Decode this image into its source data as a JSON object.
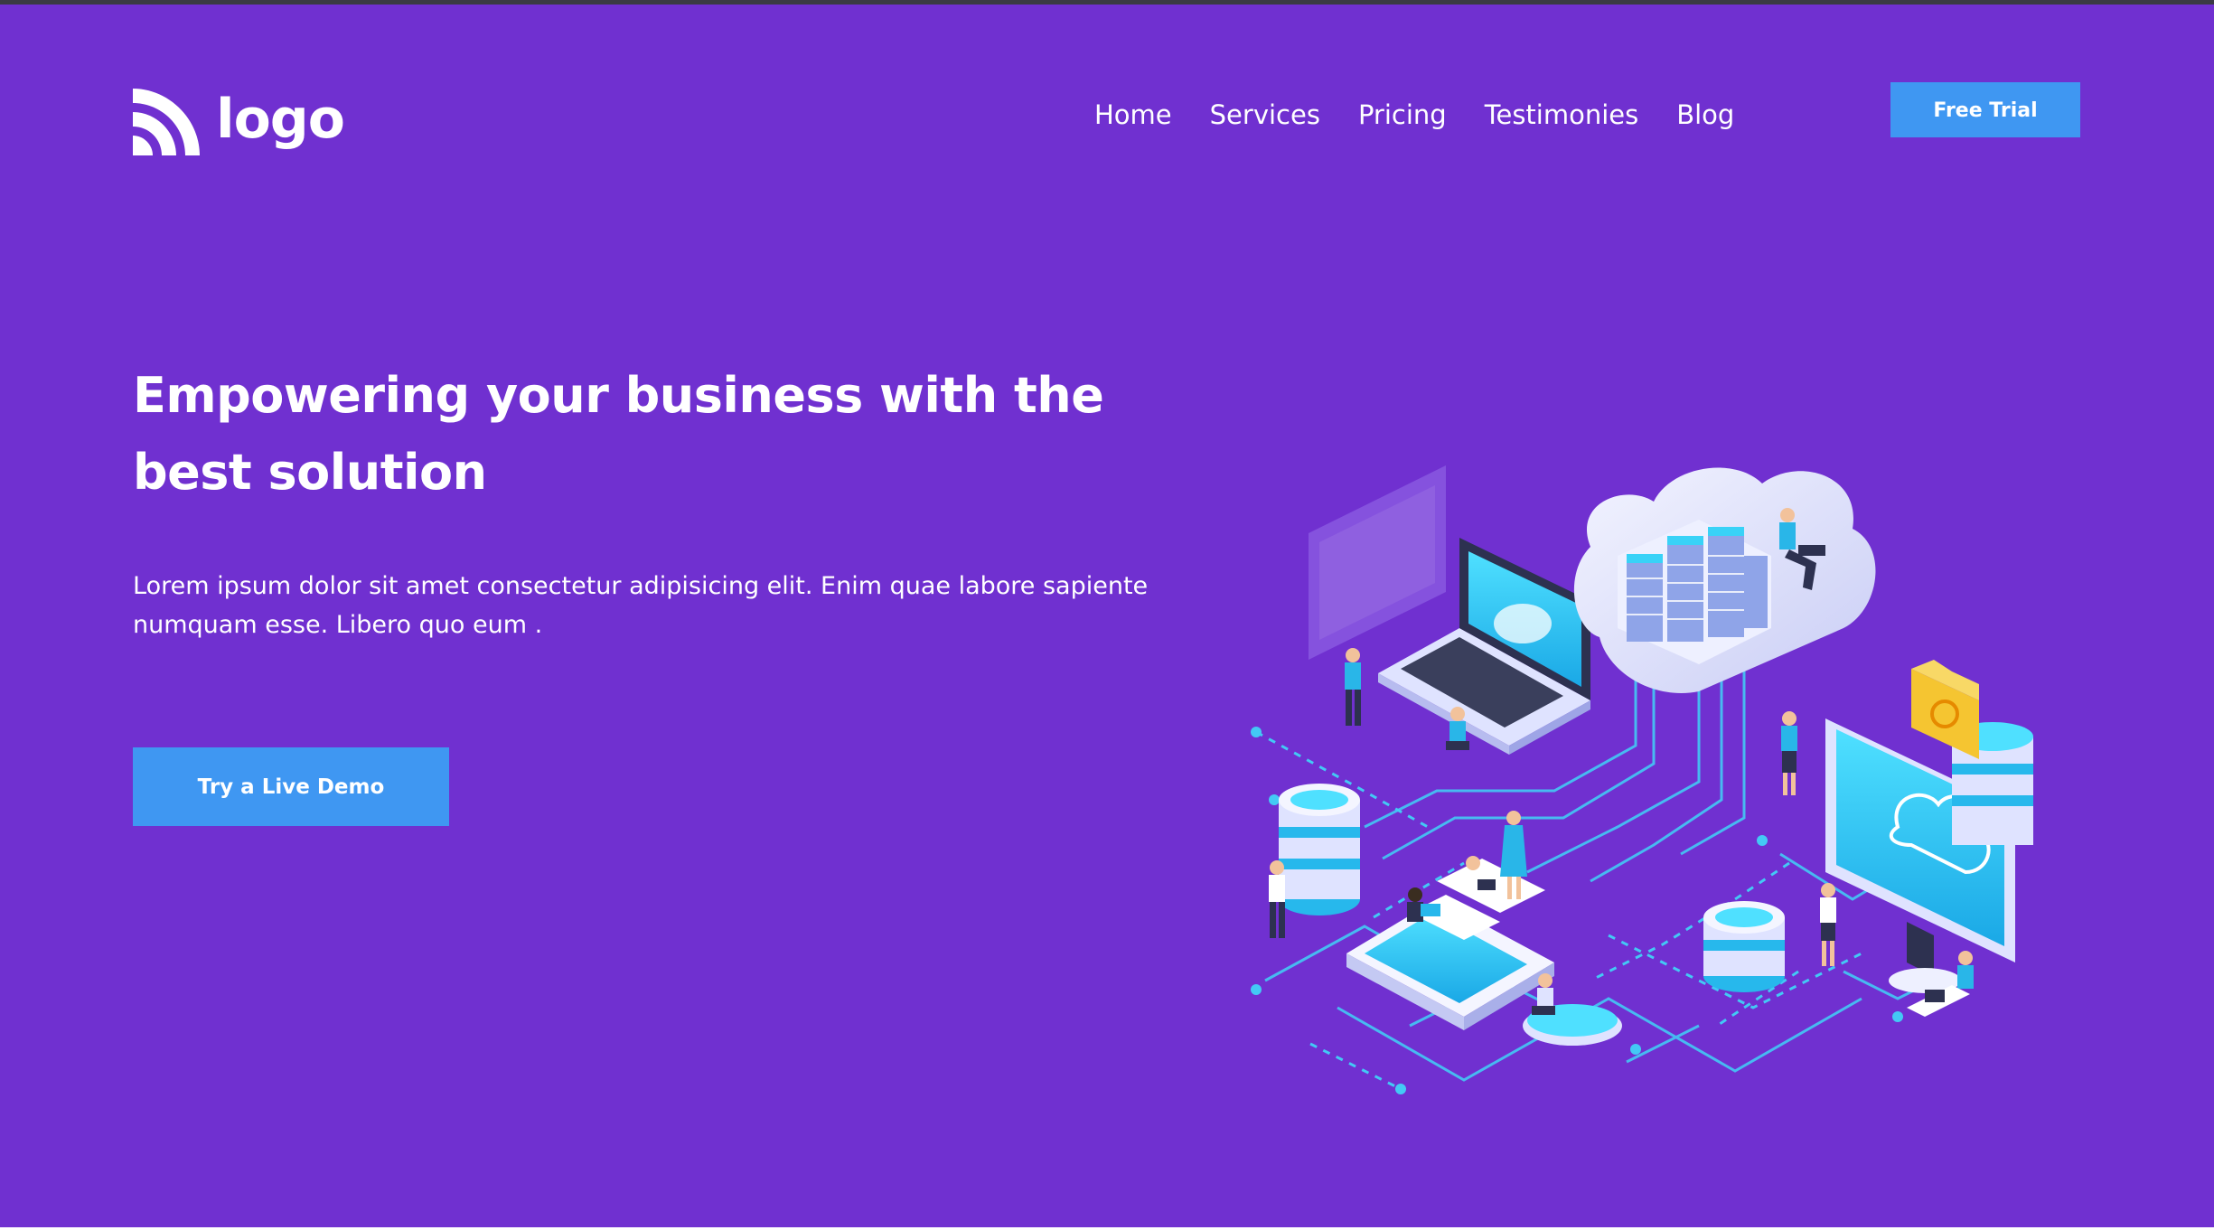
{
  "brand": {
    "logo_text": "logo",
    "logo_icon": "rss-arcs-icon"
  },
  "nav": {
    "items": [
      {
        "label": "Home"
      },
      {
        "label": "Services"
      },
      {
        "label": "Pricing"
      },
      {
        "label": "Testimonies"
      },
      {
        "label": "Blog"
      }
    ]
  },
  "header": {
    "cta_label": "Free Trial"
  },
  "hero": {
    "title": "Empowering your business with the best solution",
    "subtitle": "Lorem ipsum dolor sit amet consectetur adipisicing elit. Enim quae labore sapiente numquam esse. Libero quo eum .",
    "cta_label": "Try a Live Demo",
    "illustration": "isometric-cloud-network-illustration"
  },
  "colors": {
    "background": "#7030d0",
    "button": "#3f97f2",
    "text": "#ffffff",
    "illustration_cyan": "#27c6f0",
    "illustration_light": "#dfe3ff",
    "illustration_folder": "#f5c531"
  }
}
